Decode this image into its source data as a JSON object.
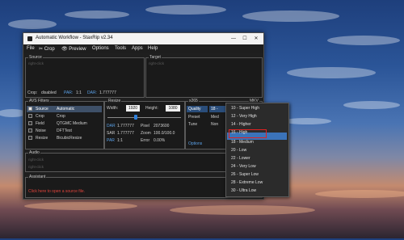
{
  "window": {
    "title": "Automatic Workflow - StaxRip v2.34",
    "controls": [
      "—",
      "☐",
      "✕"
    ]
  },
  "menu": [
    {
      "label": "File",
      "icon": ""
    },
    {
      "label": "Crop",
      "icon": "crop-icon"
    },
    {
      "label": "Preview",
      "icon": "eye-icon"
    },
    {
      "label": "Options",
      "icon": ""
    },
    {
      "label": "Tools",
      "icon": ""
    },
    {
      "label": "Apps",
      "icon": ""
    },
    {
      "label": "Help",
      "icon": ""
    }
  ],
  "source": {
    "label": "Source",
    "placeholder": "right-click",
    "crop_label": "Crop:",
    "crop_value": "disabled",
    "par_label": "PAR:",
    "par_value": "1:1",
    "dar_label": "DAR:",
    "dar_value": "1.777777"
  },
  "target": {
    "label": "Target",
    "placeholder": "right-click"
  },
  "filters": {
    "label": "AVS Filters",
    "rows": [
      {
        "checked": true,
        "name": "Source",
        "value": "Automatic",
        "selected": true
      },
      {
        "checked": false,
        "name": "Crop",
        "value": "Crop",
        "selected": false
      },
      {
        "checked": false,
        "name": "Field",
        "value": "QTGMC Medium",
        "selected": false
      },
      {
        "checked": false,
        "name": "Noise",
        "value": "DFTTest",
        "selected": false
      },
      {
        "checked": false,
        "name": "Resize",
        "value": "BicubicResize",
        "selected": false
      }
    ]
  },
  "resize": {
    "label": "Resize",
    "width_label": "Width:",
    "width_value": "1920",
    "height_label": "Height:",
    "height_value": "1080",
    "dar_label": "DAR",
    "dar_value": "1.777777",
    "pixel_label": "Pixel",
    "pixel_value": "2073600",
    "sar_label": "SAR",
    "sar_value": "1.777777",
    "zoom_label": "Zoom",
    "zoom_value": "100.0/100.0",
    "par_label": "PAR",
    "par_value": "1:1",
    "error_label": "Error",
    "error_value": "0.00%"
  },
  "encoder": {
    "label": "x265",
    "container_label": "MKV",
    "quality_label": "Quality",
    "quality_value": "18 - ",
    "preset_label": "Preset",
    "preset_value": "Med",
    "tune_label": "Tune",
    "tune_value": "Non",
    "options_label": "Options"
  },
  "quality_dropdown": {
    "items": [
      "10 - Super High",
      "12 - Very High",
      "14 - Higher",
      "16 - High",
      "18 - Medium",
      "20 - Low",
      "22 - Lower",
      "24 - Very Low",
      "26 - Super Low",
      "28 - Extreme Low",
      "30 - Ultra Low"
    ],
    "highlighted_index": 4,
    "boxed_index": 3
  },
  "audio": {
    "label": "Audio",
    "placeholder1": "right-click",
    "placeholder2": "right-click"
  },
  "assistant": {
    "label": "Assistant",
    "message": "Click here to open a source file."
  }
}
